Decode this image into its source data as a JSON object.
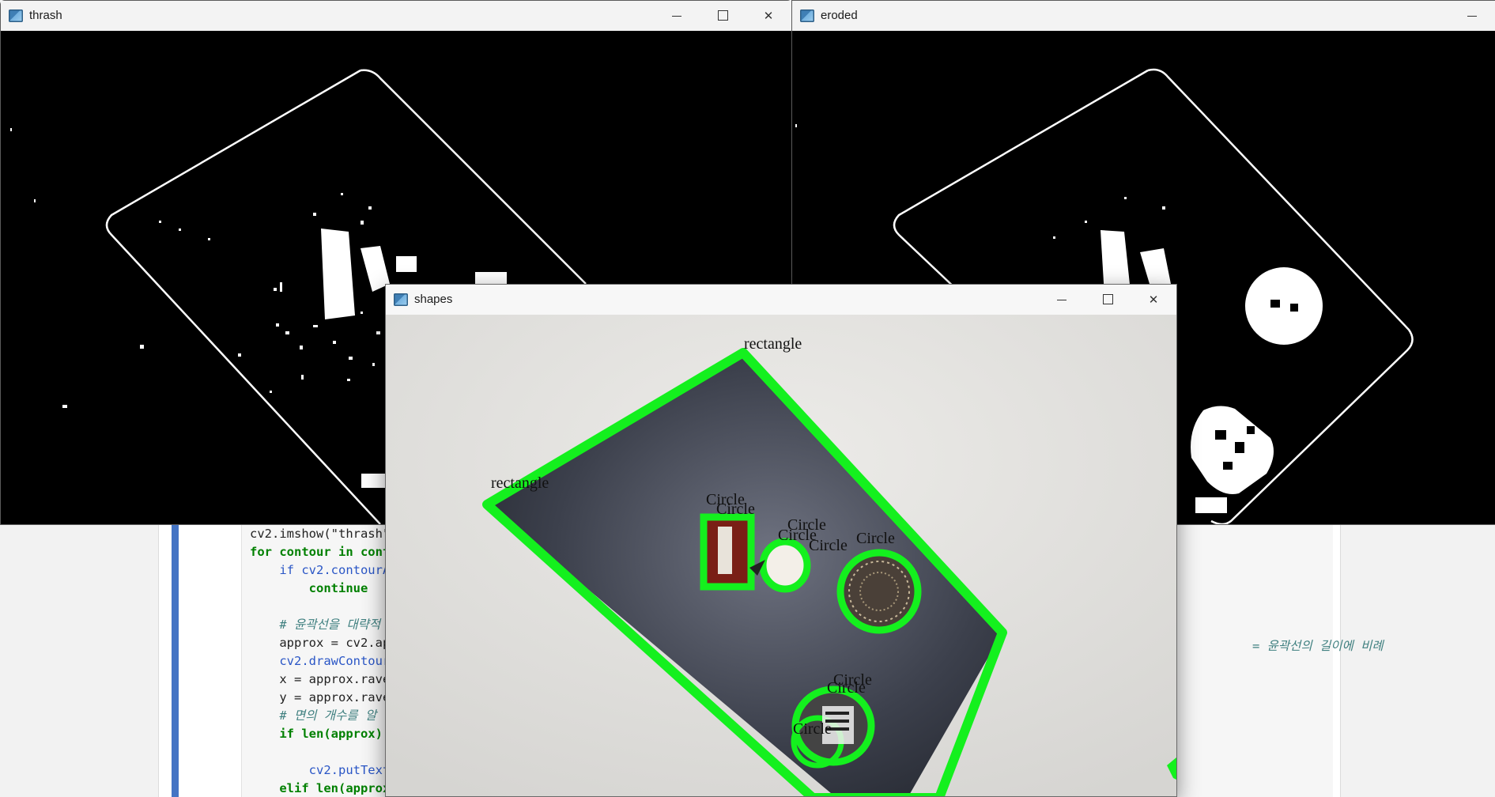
{
  "editor": {
    "code_lines": [
      "cv2.imshow(\"thrash\",",
      "for contour in conto",
      "    if cv2.contourAr",
      "        continue",
      "",
      "    # 윤곽선을 대략적",
      "    approx = cv2.app",
      "    cv2.drawContours",
      "    x = approx.ravel",
      "    y = approx.ravel",
      "    # 면의 개수를 알",
      "    if len(approx) =",
      "",
      "        cv2.putText(",
      "    elif len(approx)"
    ],
    "right_comment": "= 윤곽선의 길이에 비례"
  },
  "windows": {
    "thrash": {
      "title": "thrash",
      "minimize": "minimize",
      "maximize": "maximize",
      "close": "close"
    },
    "eroded": {
      "title": "eroded",
      "minimize": "minimize"
    },
    "shapes": {
      "title": "shapes",
      "labels": {
        "rect_top": "rectangle",
        "rect_left": "rectangle",
        "circle_1": "Circle",
        "circle_2": "Circle",
        "circle_3": "Circle",
        "circle_4": "Circle",
        "circle_5": "Circle",
        "circle_6": "Circle",
        "circle_7": "Circle",
        "circle_8": "Circle",
        "circle_9": "Circle"
      }
    }
  },
  "colors": {
    "contour_green": "#14f01e",
    "cell_bar": "#4474c4",
    "board_dark": "#3a3e4a"
  },
  "icons": [
    "window-app-icon",
    "minimize-icon",
    "maximize-icon",
    "close-icon"
  ]
}
